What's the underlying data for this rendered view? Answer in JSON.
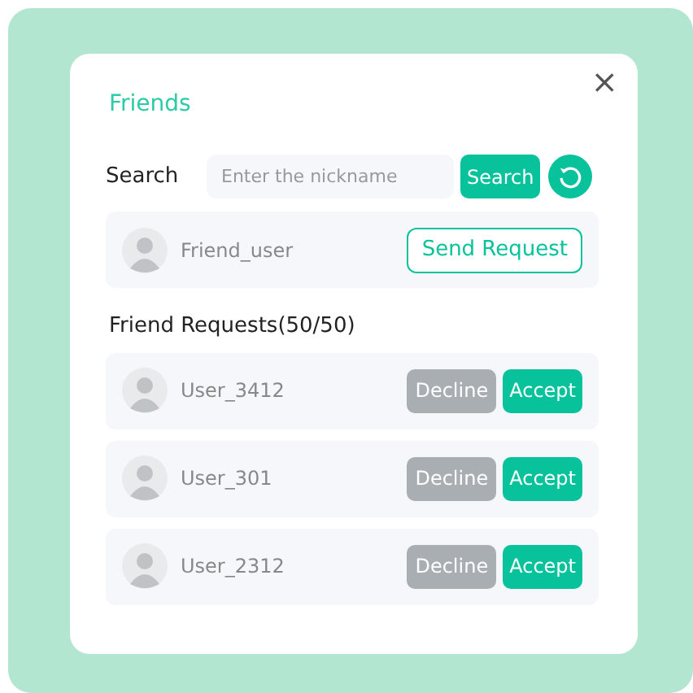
{
  "dialog": {
    "title": "Friends",
    "close": "×"
  },
  "search": {
    "label": "Search",
    "placeholder": "Enter the nickname",
    "button": "Search"
  },
  "result": {
    "name": "Friend_user",
    "button": "Send Request"
  },
  "requests": {
    "heading": "Friend Requests(50/50)",
    "items": [
      {
        "name": "User_3412",
        "decline": "Decline",
        "accept": "Accept"
      },
      {
        "name": "User_301",
        "decline": "Decline",
        "accept": "Accept"
      },
      {
        "name": "User_2312",
        "decline": "Decline",
        "accept": "Accept"
      }
    ]
  }
}
